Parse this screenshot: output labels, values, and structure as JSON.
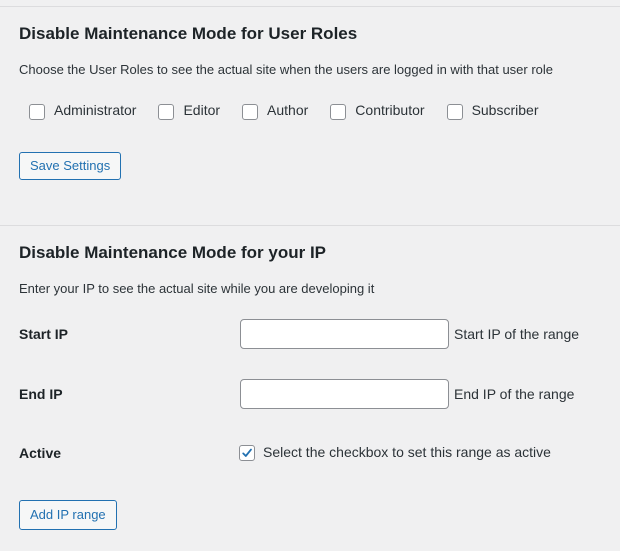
{
  "roles_section": {
    "title": "Disable Maintenance Mode for User Roles",
    "description": "Choose the User Roles to see the actual site when the users are logged in with that user role",
    "roles": [
      {
        "label": "Administrator",
        "checked": false
      },
      {
        "label": "Editor",
        "checked": false
      },
      {
        "label": "Author",
        "checked": false
      },
      {
        "label": "Contributor",
        "checked": false
      },
      {
        "label": "Subscriber",
        "checked": false
      }
    ],
    "save_label": "Save Settings"
  },
  "ip_section": {
    "title": "Disable Maintenance Mode for your IP",
    "description": "Enter your IP to see the actual site while you are developing it",
    "start_ip": {
      "label": "Start IP",
      "value": "",
      "hint": "Start IP of the range"
    },
    "end_ip": {
      "label": "End IP",
      "value": "",
      "hint": "End IP of the range"
    },
    "active": {
      "label": "Active",
      "checked": true,
      "hint": "Select the checkbox to set this range as active"
    },
    "add_label": "Add IP range"
  },
  "colors": {
    "accent": "#2271b1",
    "background": "#f0f0f1",
    "border": "#8c8f94"
  }
}
